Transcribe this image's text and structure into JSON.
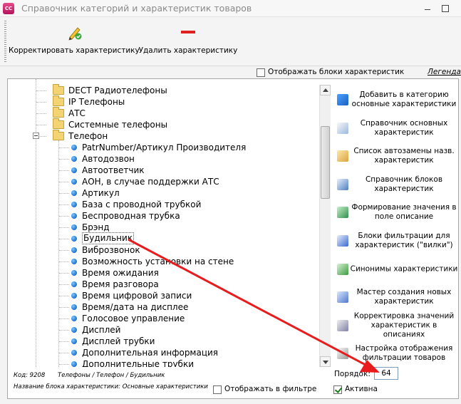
{
  "window": {
    "title": "Справочник категорий и характеристик товаров",
    "icon_text": "CC"
  },
  "toolbar": {
    "edit_label": "Корректировать характеристику",
    "delete_label": "Удалить характеристику"
  },
  "options": {
    "show_blocks_label": "Отображать блоки характеристик",
    "legend_label": "Легенда"
  },
  "tree": {
    "folders": [
      "DECT Радиотелефоны",
      "IP Телефоны",
      "АТС",
      "Системные телефоны",
      "Телефон"
    ],
    "items": [
      "PatrNumber/Артикул Производителя",
      "Автодозвон",
      "Автоответчик",
      "АОН, в случае поддержки АТС",
      "Артикул",
      "База с проводной трубкой",
      "Беспроводная трубка",
      "Брэнд",
      "Будильник",
      "Виброзвонок",
      "Возможность установки на стене",
      "Время ожидания",
      "Время разговора",
      "Время цифровой записи",
      "Время/дата на дисплее",
      "Голосовое управление",
      "Дисплей",
      "Дисплей трубки",
      "Дополнительная информация",
      "Дополнительные трубки"
    ],
    "selected_item": "Будильник"
  },
  "actions": [
    "Добавить в категорию основные характеристики",
    "Справочник основных характеристик",
    "Список автозамены назв. характеристик",
    "Справочник блоков характеристик",
    "Формирование значения в поле описание",
    "Блоки фильтрации для характеристик (\"вилки\")",
    "Синонимы характеристики",
    "Мастер создания новых характеристик",
    "Корректировка значений характеристик в описаниях",
    "Настройка отображения фильтрации товаров"
  ],
  "order": {
    "label": "Порядок:",
    "value": "64"
  },
  "info": {
    "code": "Код: 9208",
    "path": "Телефоны / Телефон / Будильник",
    "block": "Название блока характеристики: Основные характеристики"
  },
  "flags": {
    "show_in_filter_label": "Отображать в фильтре",
    "show_in_filter_checked": false,
    "active_label": "Активна",
    "active_checked": true
  },
  "colors": {
    "annotation_arrow": "#e81c1c",
    "bullet": "#1d6fd0",
    "folder": "#f3d374"
  }
}
